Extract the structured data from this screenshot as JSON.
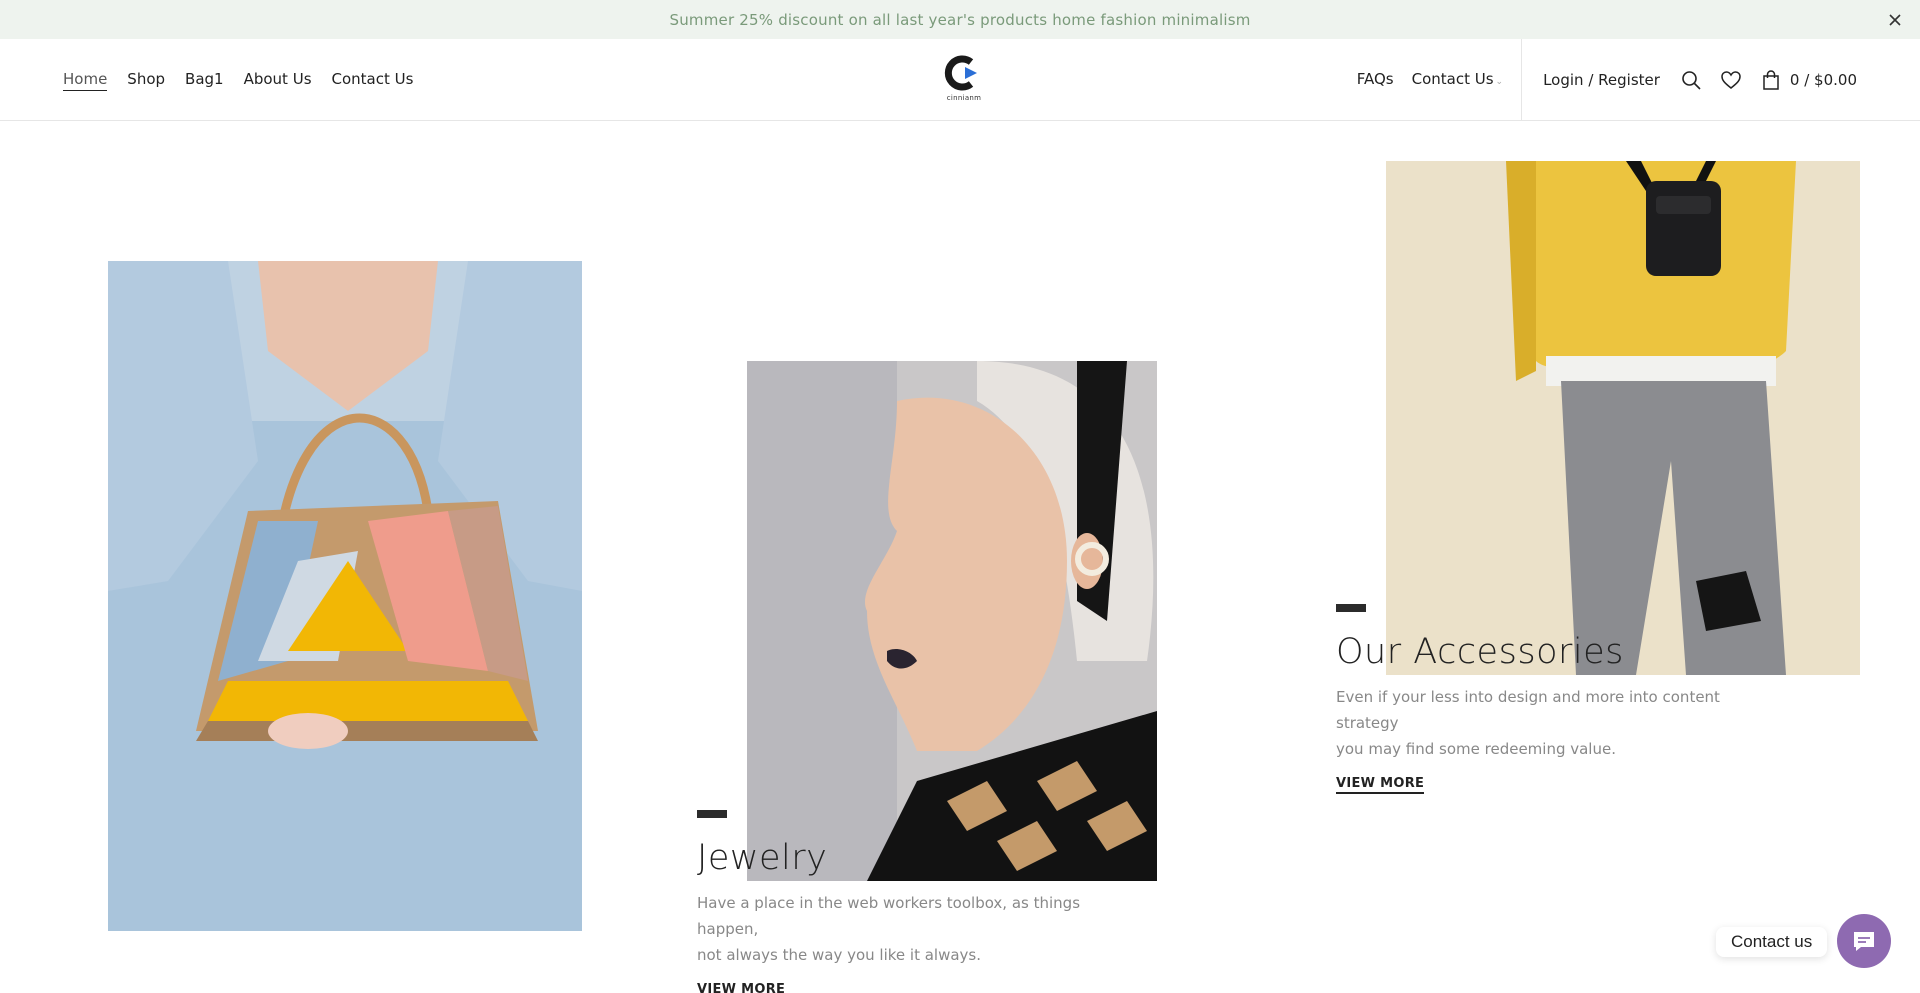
{
  "announcement": {
    "text": "Summer 25% discount on all last year's products home fashion minimalism"
  },
  "nav_left": [
    {
      "label": "Home"
    },
    {
      "label": "Shop"
    },
    {
      "label": "Bag1"
    },
    {
      "label": "About Us"
    },
    {
      "label": "Contact Us"
    }
  ],
  "logo": {
    "text": "cinnianm"
  },
  "nav_right": [
    {
      "label": "FAQs"
    },
    {
      "label": "Contact Us"
    }
  ],
  "account": {
    "login_label": "Login / Register"
  },
  "cart": {
    "summary": "0 / $0.00"
  },
  "sections": {
    "jewelry": {
      "title": "Jewelry",
      "desc_line1": "Have a place in the web workers toolbox, as things happen,",
      "desc_line2": "not always the way you like it always.",
      "link": "VIEW MORE"
    },
    "accessories": {
      "title": "Our Accessories",
      "desc_line1": "Even if your less into design and more into content strategy",
      "desc_line2": "you may find some redeeming value.",
      "link": "VIEW MORE"
    }
  },
  "floating_contact": {
    "label": "Contact us"
  },
  "colors": {
    "announcement_bg": "#eef3ee",
    "announcement_text": "#7a9a7a",
    "contact_fab": "#8e6ab1"
  }
}
